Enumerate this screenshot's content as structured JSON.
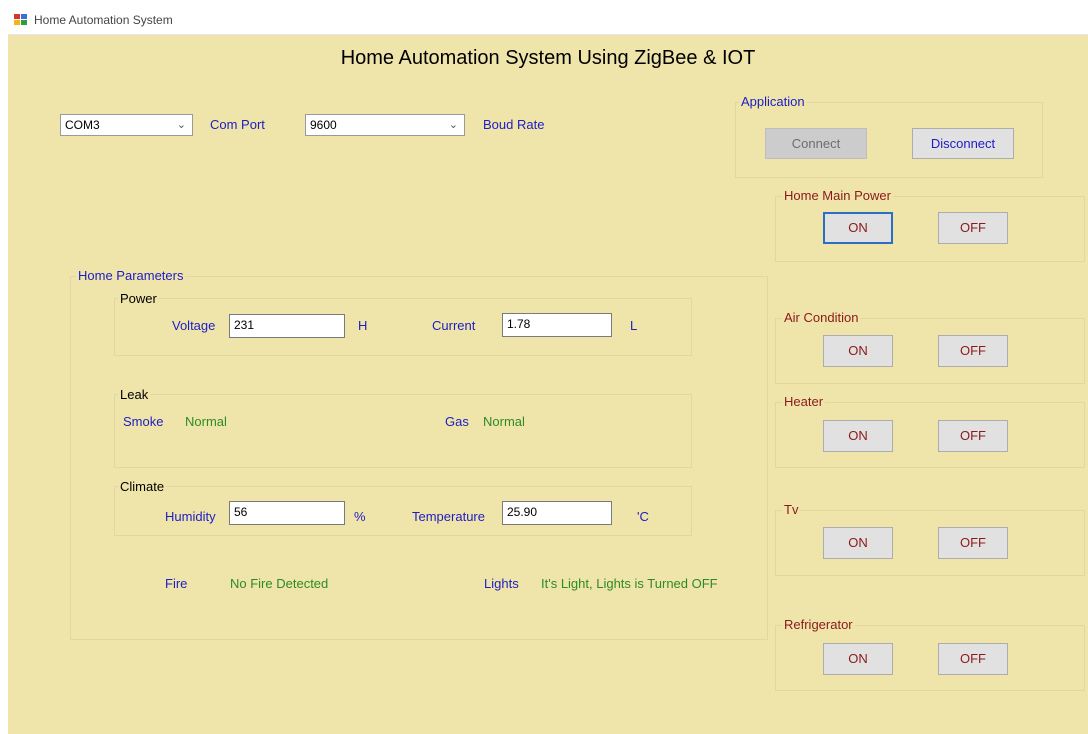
{
  "window": {
    "title": "Home Automation System"
  },
  "heading": "Home Automation System Using ZigBee & IOT",
  "connection": {
    "com_port_value": "COM3",
    "com_port_label": "Com Port",
    "baud_rate_value": "9600",
    "baud_rate_label": "Boud Rate"
  },
  "application": {
    "title": "Application",
    "connect_label": "Connect",
    "disconnect_label": "Disconnect"
  },
  "appliances": [
    {
      "title": "Home Main Power",
      "on_label": "ON",
      "off_label": "OFF"
    },
    {
      "title": "Air Condition",
      "on_label": "ON",
      "off_label": "OFF"
    },
    {
      "title": "Heater",
      "on_label": "ON",
      "off_label": "OFF"
    },
    {
      "title": "Tv",
      "on_label": "ON",
      "off_label": "OFF"
    },
    {
      "title": "Refrigerator",
      "on_label": "ON",
      "off_label": "OFF"
    }
  ],
  "parameters": {
    "title": "Home Parameters",
    "power": {
      "title": "Power",
      "voltage_label": "Voltage",
      "voltage_value": "231",
      "voltage_flag": "H",
      "current_label": "Current",
      "current_value": "1.78",
      "current_flag": "L"
    },
    "leak": {
      "title": "Leak",
      "smoke_label": "Smoke",
      "smoke_status": "Normal",
      "gas_label": "Gas",
      "gas_status": "Normal"
    },
    "climate": {
      "title": "Climate",
      "humidity_label": "Humidity",
      "humidity_value": "56",
      "humidity_unit": "%",
      "temperature_label": "Temperature",
      "temperature_value": "25.90",
      "temperature_unit": "'C"
    },
    "fire_label": "Fire",
    "fire_status": "No Fire Detected",
    "lights_label": "Lights",
    "lights_status": "It's Light, Lights is Turned OFF"
  },
  "colors": {
    "background": "#efe5ab",
    "label_blue": "#1d1dc4",
    "status_green": "#2e8b22",
    "button_text": "#8b1a1a",
    "focus_border": "#2a6fc4"
  }
}
